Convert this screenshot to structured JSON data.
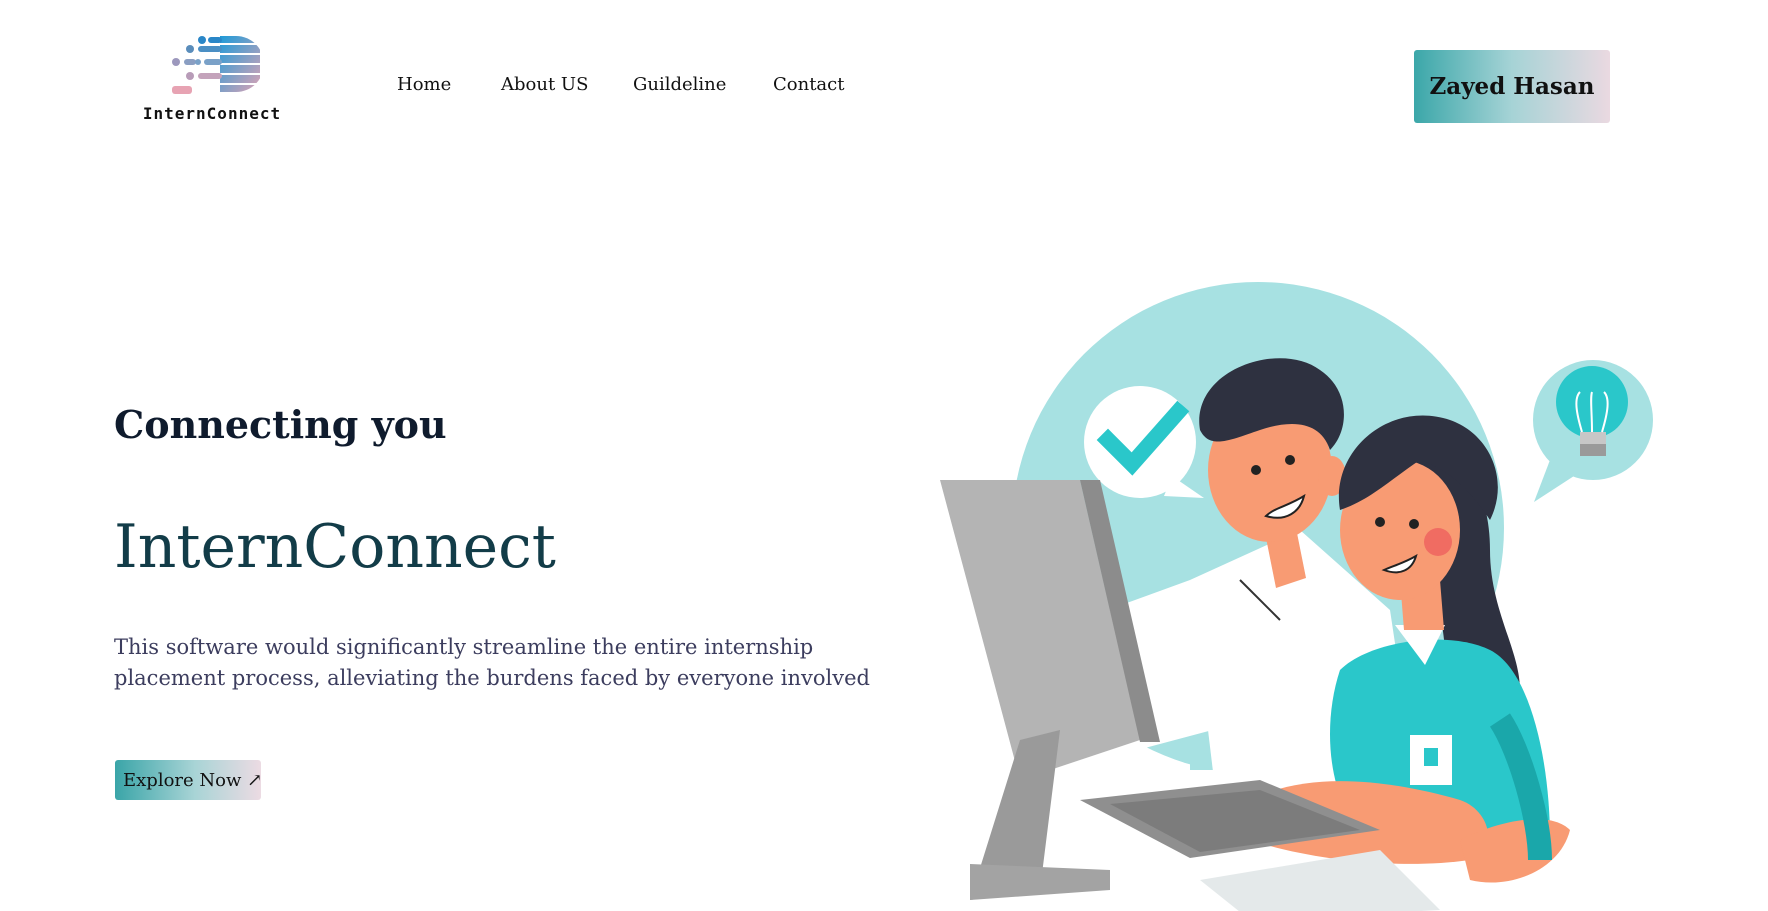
{
  "brand": {
    "logo_text": "InternConnect"
  },
  "nav": {
    "items": [
      {
        "label": "Home"
      },
      {
        "label": "About US"
      },
      {
        "label": "Guildeline"
      },
      {
        "label": "Contact"
      }
    ]
  },
  "user": {
    "name": "Zayed Hasan"
  },
  "hero": {
    "subtitle": "Connecting you",
    "title": "InternConnect",
    "description": "This software would significantly streamline the entire internship placement process, alleviating the burdens faced by everyone involved",
    "cta_label": "Explore Now ↗"
  },
  "colors": {
    "accent_teal": "#2ac7ca",
    "heading_dark": "#0f1b2d",
    "title_teal_dark": "#123c48",
    "body_text": "#3c3d5e",
    "gradient_start": "#3ba7a9",
    "gradient_end": "#ead9e1"
  },
  "icons": {
    "logo": "interconnect-logo",
    "check": "check-bubble-icon",
    "idea": "lightbulb-bubble-icon",
    "explore_arrow": "arrow-up-right"
  }
}
